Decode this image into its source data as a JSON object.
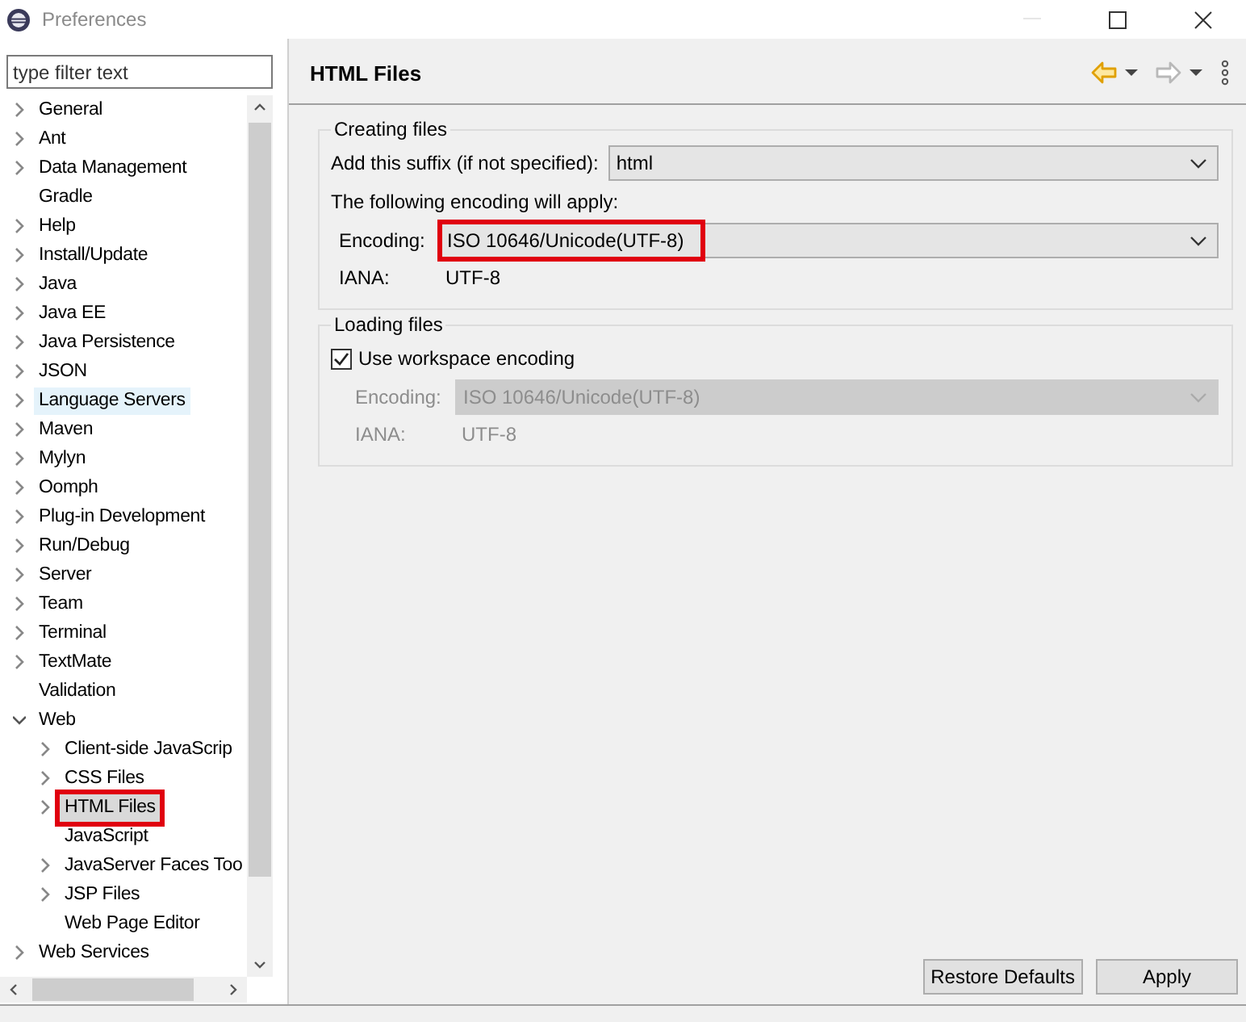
{
  "window": {
    "title": "Preferences"
  },
  "filter": {
    "placeholder": "type filter text"
  },
  "tree": [
    {
      "label": "General",
      "expandable": true,
      "expanded": false,
      "selected": false,
      "hovered": false,
      "highlighted": false
    },
    {
      "label": "Ant",
      "expandable": true,
      "expanded": false,
      "selected": false,
      "hovered": false,
      "highlighted": false
    },
    {
      "label": "Data Management",
      "expandable": true,
      "expanded": false,
      "selected": false,
      "hovered": false,
      "highlighted": false
    },
    {
      "label": "Gradle",
      "expandable": false,
      "selected": false,
      "hovered": false,
      "highlighted": false
    },
    {
      "label": "Help",
      "expandable": true,
      "expanded": false,
      "selected": false,
      "hovered": false,
      "highlighted": false
    },
    {
      "label": "Install/Update",
      "expandable": true,
      "expanded": false,
      "selected": false,
      "hovered": false,
      "highlighted": false
    },
    {
      "label": "Java",
      "expandable": true,
      "expanded": false,
      "selected": false,
      "hovered": false,
      "highlighted": false
    },
    {
      "label": "Java EE",
      "expandable": true,
      "expanded": false,
      "selected": false,
      "hovered": false,
      "highlighted": false
    },
    {
      "label": "Java Persistence",
      "expandable": true,
      "expanded": false,
      "selected": false,
      "hovered": false,
      "highlighted": false
    },
    {
      "label": "JSON",
      "expandable": true,
      "expanded": false,
      "selected": false,
      "hovered": false,
      "highlighted": false
    },
    {
      "label": "Language Servers",
      "expandable": true,
      "expanded": false,
      "selected": false,
      "hovered": true,
      "highlighted": false
    },
    {
      "label": "Maven",
      "expandable": true,
      "expanded": false,
      "selected": false,
      "hovered": false,
      "highlighted": false
    },
    {
      "label": "Mylyn",
      "expandable": true,
      "expanded": false,
      "selected": false,
      "hovered": false,
      "highlighted": false
    },
    {
      "label": "Oomph",
      "expandable": true,
      "expanded": false,
      "selected": false,
      "hovered": false,
      "highlighted": false
    },
    {
      "label": "Plug-in Development",
      "expandable": true,
      "expanded": false,
      "selected": false,
      "hovered": false,
      "highlighted": false
    },
    {
      "label": "Run/Debug",
      "expandable": true,
      "expanded": false,
      "selected": false,
      "hovered": false,
      "highlighted": false
    },
    {
      "label": "Server",
      "expandable": true,
      "expanded": false,
      "selected": false,
      "hovered": false,
      "highlighted": false
    },
    {
      "label": "Team",
      "expandable": true,
      "expanded": false,
      "selected": false,
      "hovered": false,
      "highlighted": false
    },
    {
      "label": "Terminal",
      "expandable": true,
      "expanded": false,
      "selected": false,
      "hovered": false,
      "highlighted": false
    },
    {
      "label": "TextMate",
      "expandable": true,
      "expanded": false,
      "selected": false,
      "hovered": false,
      "highlighted": false
    },
    {
      "label": "Validation",
      "expandable": false,
      "selected": false,
      "hovered": false,
      "highlighted": false
    },
    {
      "label": "Web",
      "expandable": true,
      "expanded": true,
      "selected": false,
      "hovered": false,
      "highlighted": false,
      "children": [
        {
          "label": "Client-side JavaScrip",
          "expandable": true,
          "expanded": false,
          "selected": false,
          "hovered": false,
          "highlighted": false
        },
        {
          "label": "CSS Files",
          "expandable": true,
          "expanded": false,
          "selected": false,
          "hovered": false,
          "highlighted": false
        },
        {
          "label": "HTML Files",
          "expandable": true,
          "expanded": false,
          "selected": true,
          "hovered": false,
          "highlighted": true
        },
        {
          "label": "JavaScript",
          "expandable": false,
          "selected": false,
          "hovered": false,
          "highlighted": false
        },
        {
          "label": "JavaServer Faces Too",
          "expandable": true,
          "expanded": false,
          "selected": false,
          "hovered": false,
          "highlighted": false
        },
        {
          "label": "JSP Files",
          "expandable": true,
          "expanded": false,
          "selected": false,
          "hovered": false,
          "highlighted": false
        },
        {
          "label": "Web Page Editor",
          "expandable": false,
          "selected": false,
          "hovered": false,
          "highlighted": false
        }
      ]
    },
    {
      "label": "Web Services",
      "expandable": true,
      "expanded": false,
      "selected": false,
      "hovered": false,
      "highlighted": false
    }
  ],
  "page": {
    "title": "HTML Files"
  },
  "toolbar": [
    {
      "kind": "back",
      "disabled": false
    },
    {
      "kind": "dropdown",
      "disabled": false
    },
    {
      "kind": "forward",
      "disabled": true
    },
    {
      "kind": "dropdown",
      "disabled": false
    },
    {
      "kind": "more",
      "disabled": false
    }
  ],
  "groups": [
    {
      "title": "Creating files",
      "rows": [
        {
          "kind": "combo",
          "label": "Add this suffix (if not specified):",
          "value": "html",
          "disabled": false,
          "highlighted": false
        },
        {
          "kind": "text",
          "text": "The following encoding will apply:"
        },
        {
          "kind": "combo",
          "label": "Encoding:",
          "value": "ISO 10646/Unicode(UTF-8)",
          "disabled": false,
          "highlighted": true
        },
        {
          "kind": "pair",
          "label": "IANA:",
          "value": "UTF-8",
          "disabled": false
        }
      ]
    },
    {
      "title": "Loading files",
      "rows": [
        {
          "kind": "checkbox",
          "label": "Use workspace encoding",
          "checked": true
        },
        {
          "kind": "combo",
          "label": "Encoding:",
          "value": "ISO 10646/Unicode(UTF-8)",
          "disabled": true,
          "highlighted": false
        },
        {
          "kind": "pair",
          "label": "IANA:",
          "value": "UTF-8",
          "disabled": true
        }
      ]
    }
  ],
  "buttons": [
    {
      "label": "Restore Defaults"
    },
    {
      "label": "Apply"
    }
  ]
}
